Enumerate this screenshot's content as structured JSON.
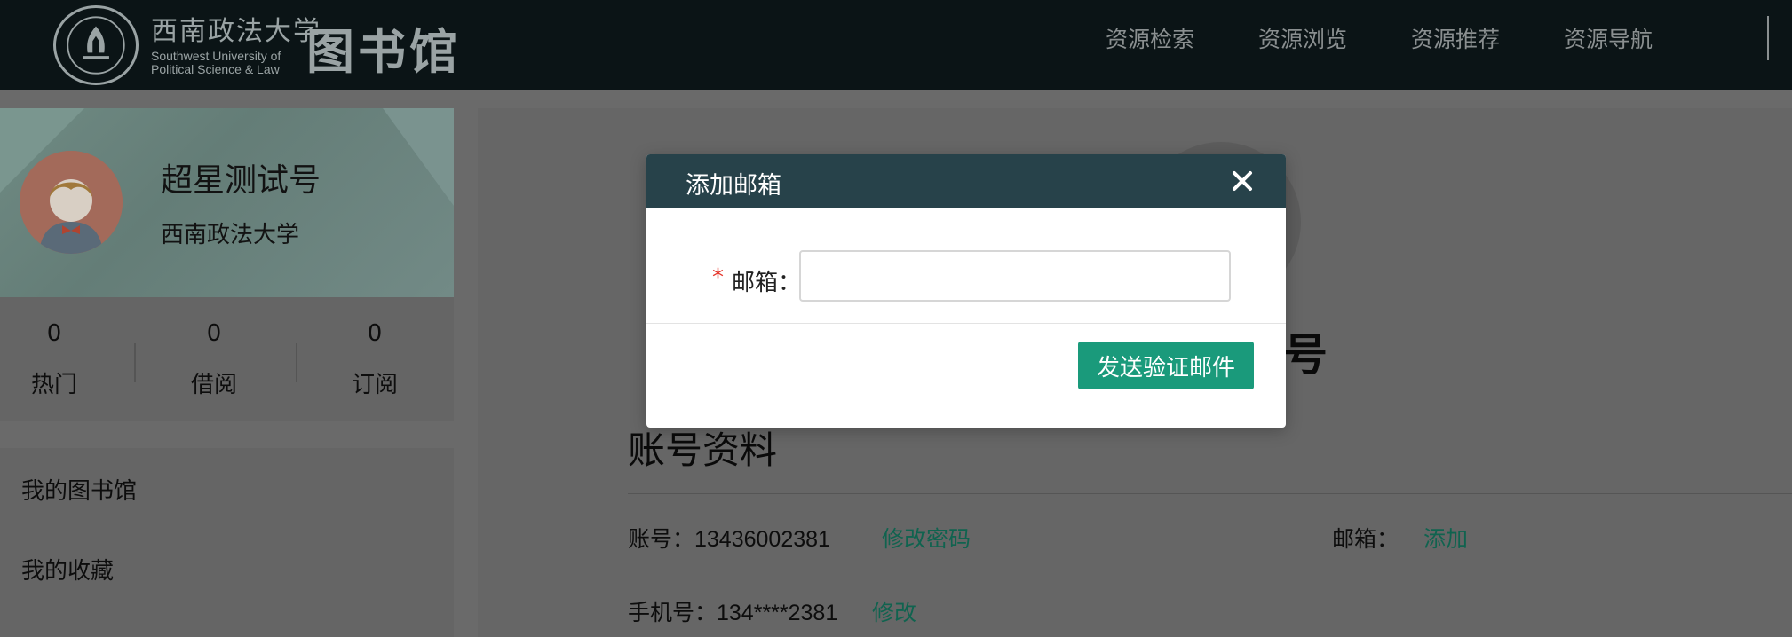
{
  "header": {
    "logo_cn": "西南政法大学",
    "logo_en_line1": "Southwest University of",
    "logo_en_line2": "Political Science & Law",
    "logo_library": "图书馆",
    "nav": [
      "资源检索",
      "资源浏览",
      "资源推荐",
      "资源导航"
    ]
  },
  "profile": {
    "name": "超星测试号",
    "school": "西南政法大学"
  },
  "stats": [
    {
      "value": "0",
      "label": "热门"
    },
    {
      "value": "0",
      "label": "借阅"
    },
    {
      "value": "0",
      "label": "订阅"
    }
  ],
  "menu": [
    "我的图书馆",
    "我的收藏"
  ],
  "main": {
    "name_fragment": "号",
    "section_title": "账号资料",
    "account_label": "账号：13436002381",
    "change_password": "修改密码",
    "email_label": "邮箱：",
    "email_add": "添加",
    "phone_label": "手机号：134****2381",
    "phone_change": "修改"
  },
  "modal": {
    "title": "添加邮箱",
    "required_mark": "*",
    "field_label": "邮箱：",
    "input_value": "",
    "input_placeholder": "",
    "send_button": "发送验证邮件"
  },
  "colors": {
    "topbar": "#0b1416",
    "modal_header": "#27424a",
    "primary_button": "#1a9a7b",
    "link": "#10634f",
    "required": "#e5342a"
  },
  "icons": {
    "close": "close-icon",
    "seal": "university-seal-icon",
    "avatar": "user-avatar-icon"
  }
}
